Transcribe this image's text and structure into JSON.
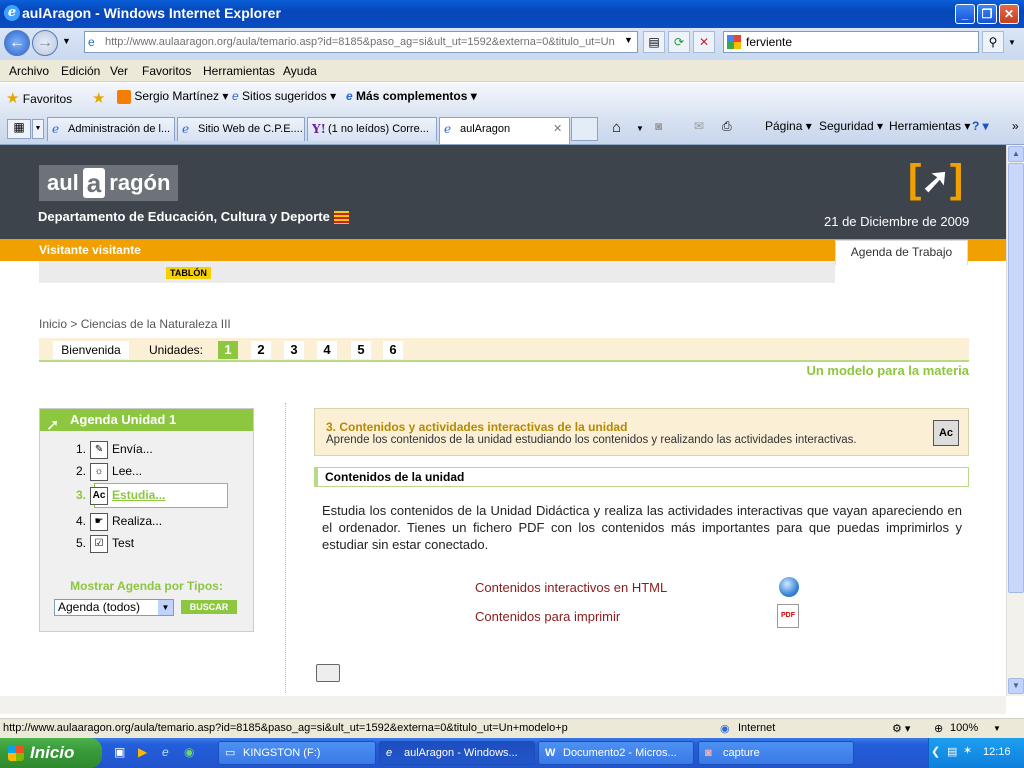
{
  "window": {
    "title": "aulAragon - Windows Internet Explorer"
  },
  "address": {
    "url": "http://www.aulaaragon.org/aula/temario.asp?id=8185&paso_ag=si&ult_ut=1592&externa=0&titulo_ut=Un",
    "search": "ferviente"
  },
  "menu": [
    "Archivo",
    "Edición",
    "Ver",
    "Favoritos",
    "Herramientas",
    "Ayuda"
  ],
  "favorites": {
    "label": "Favoritos",
    "items": [
      "Sergio Martínez",
      "Sitios sugeridos",
      "Más complementos"
    ]
  },
  "tabs": [
    {
      "label": "Administración de l..."
    },
    {
      "label": "Sitio Web de C.P.E...."
    },
    {
      "label": "(1 no leídos) Corre..."
    },
    {
      "label": "aulAragon"
    }
  ],
  "commands": [
    "Página",
    "Seguridad",
    "Herramientas"
  ],
  "header": {
    "logo_left": "aul",
    "logo_a": "a",
    "logo_right": "ragón",
    "department": "Departamento de Educación, Cultura y Deporte",
    "date": "21 de Diciembre de 2009",
    "visitor": "Visitante visitante",
    "agenda_tab": "Agenda de Trabajo",
    "tablon": "TABLÓN"
  },
  "breadcrumb": "Inicio > Ciencias de la Naturaleza III",
  "units": {
    "welcome": "Bienvenida",
    "label": "Unidades:",
    "numbers": [
      "1",
      "2",
      "3",
      "4",
      "5",
      "6"
    ],
    "selected": "1"
  },
  "model_title": "Un modelo para la materia",
  "agenda": {
    "title": "Agenda Unidad 1",
    "items": [
      {
        "num": "1.",
        "label": "Envía..."
      },
      {
        "num": "2.",
        "label": "Lee..."
      },
      {
        "num": "3.",
        "label": "Estudia..."
      },
      {
        "num": "4.",
        "label": "Realiza..."
      },
      {
        "num": "5.",
        "label": "Test"
      }
    ],
    "filter_label": "Mostrar Agenda por Tipos:",
    "filter_value": "Agenda (todos)",
    "search_button": "BUSCAR"
  },
  "content": {
    "title": "3. Contenidos y actividades interactivas de la unidad",
    "description": "Aprende los contenidos de la unidad estudiando los contenidos y realizando las actividades interactivas.",
    "section": "Contenidos de la unidad",
    "paragraph": "Estudia los contenidos de la Unidad Didáctica y realiza las actividades interactivas que vayan apareciendo en el ordenador. Tienes un fichero PDF con los contenidos más importantes para que puedas imprimirlos y estudiar sin estar conectado.",
    "link_html": "Contenidos interactivos en HTML",
    "link_print": "Contenidos para imprimir"
  },
  "status": {
    "url": "http://www.aulaaragon.org/aula/temario.asp?id=8185&paso_ag=si&ult_ut=1592&externa=0&titulo_ut=Un+modelo+p",
    "zone": "Internet",
    "zoom": "100%"
  },
  "taskbar": {
    "start": "Inicio",
    "items": [
      "KINGSTON (F:)",
      "aulAragon - Windows...",
      "Documento2 - Micros...",
      "capture"
    ],
    "clock": "12:16"
  }
}
